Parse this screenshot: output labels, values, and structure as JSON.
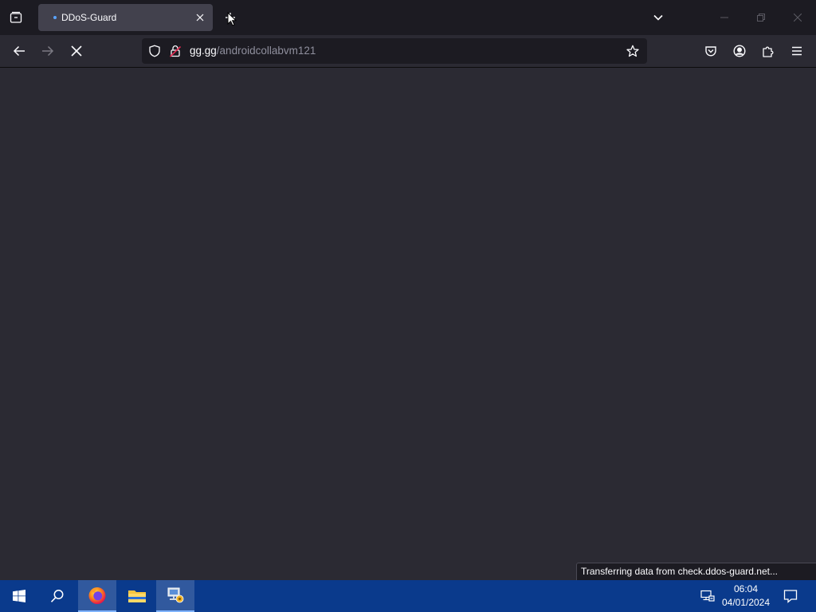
{
  "browser": {
    "tab": {
      "title": "DDoS-Guard"
    },
    "url": {
      "domain": "gg.gg",
      "path": "/androidcollabvm121"
    },
    "status_text": "Transferring data from check.ddos-guard.net..."
  },
  "icons": {
    "tab_list": "list-all-tabs-icon",
    "tab_close": "close-icon",
    "new_tab": "plus-icon",
    "back": "arrow-left-icon",
    "forward": "arrow-right-icon",
    "stop": "stop-x-icon",
    "shield": "tracking-shield-icon",
    "insecure": "insecure-lock-icon",
    "bookmark": "star-icon",
    "pocket": "pocket-icon",
    "account": "account-icon",
    "extensions": "puzzle-icon",
    "menu": "hamburger-menu-icon"
  },
  "taskbar": {
    "time": "06:04",
    "date": "04/01/2024"
  },
  "colors": {
    "tabstrip_bg": "#1c1b22",
    "toolbar_bg": "#2b2a33",
    "taskbar_bg": "#0a3a8c",
    "loading_accent": "#5aa3ff"
  }
}
